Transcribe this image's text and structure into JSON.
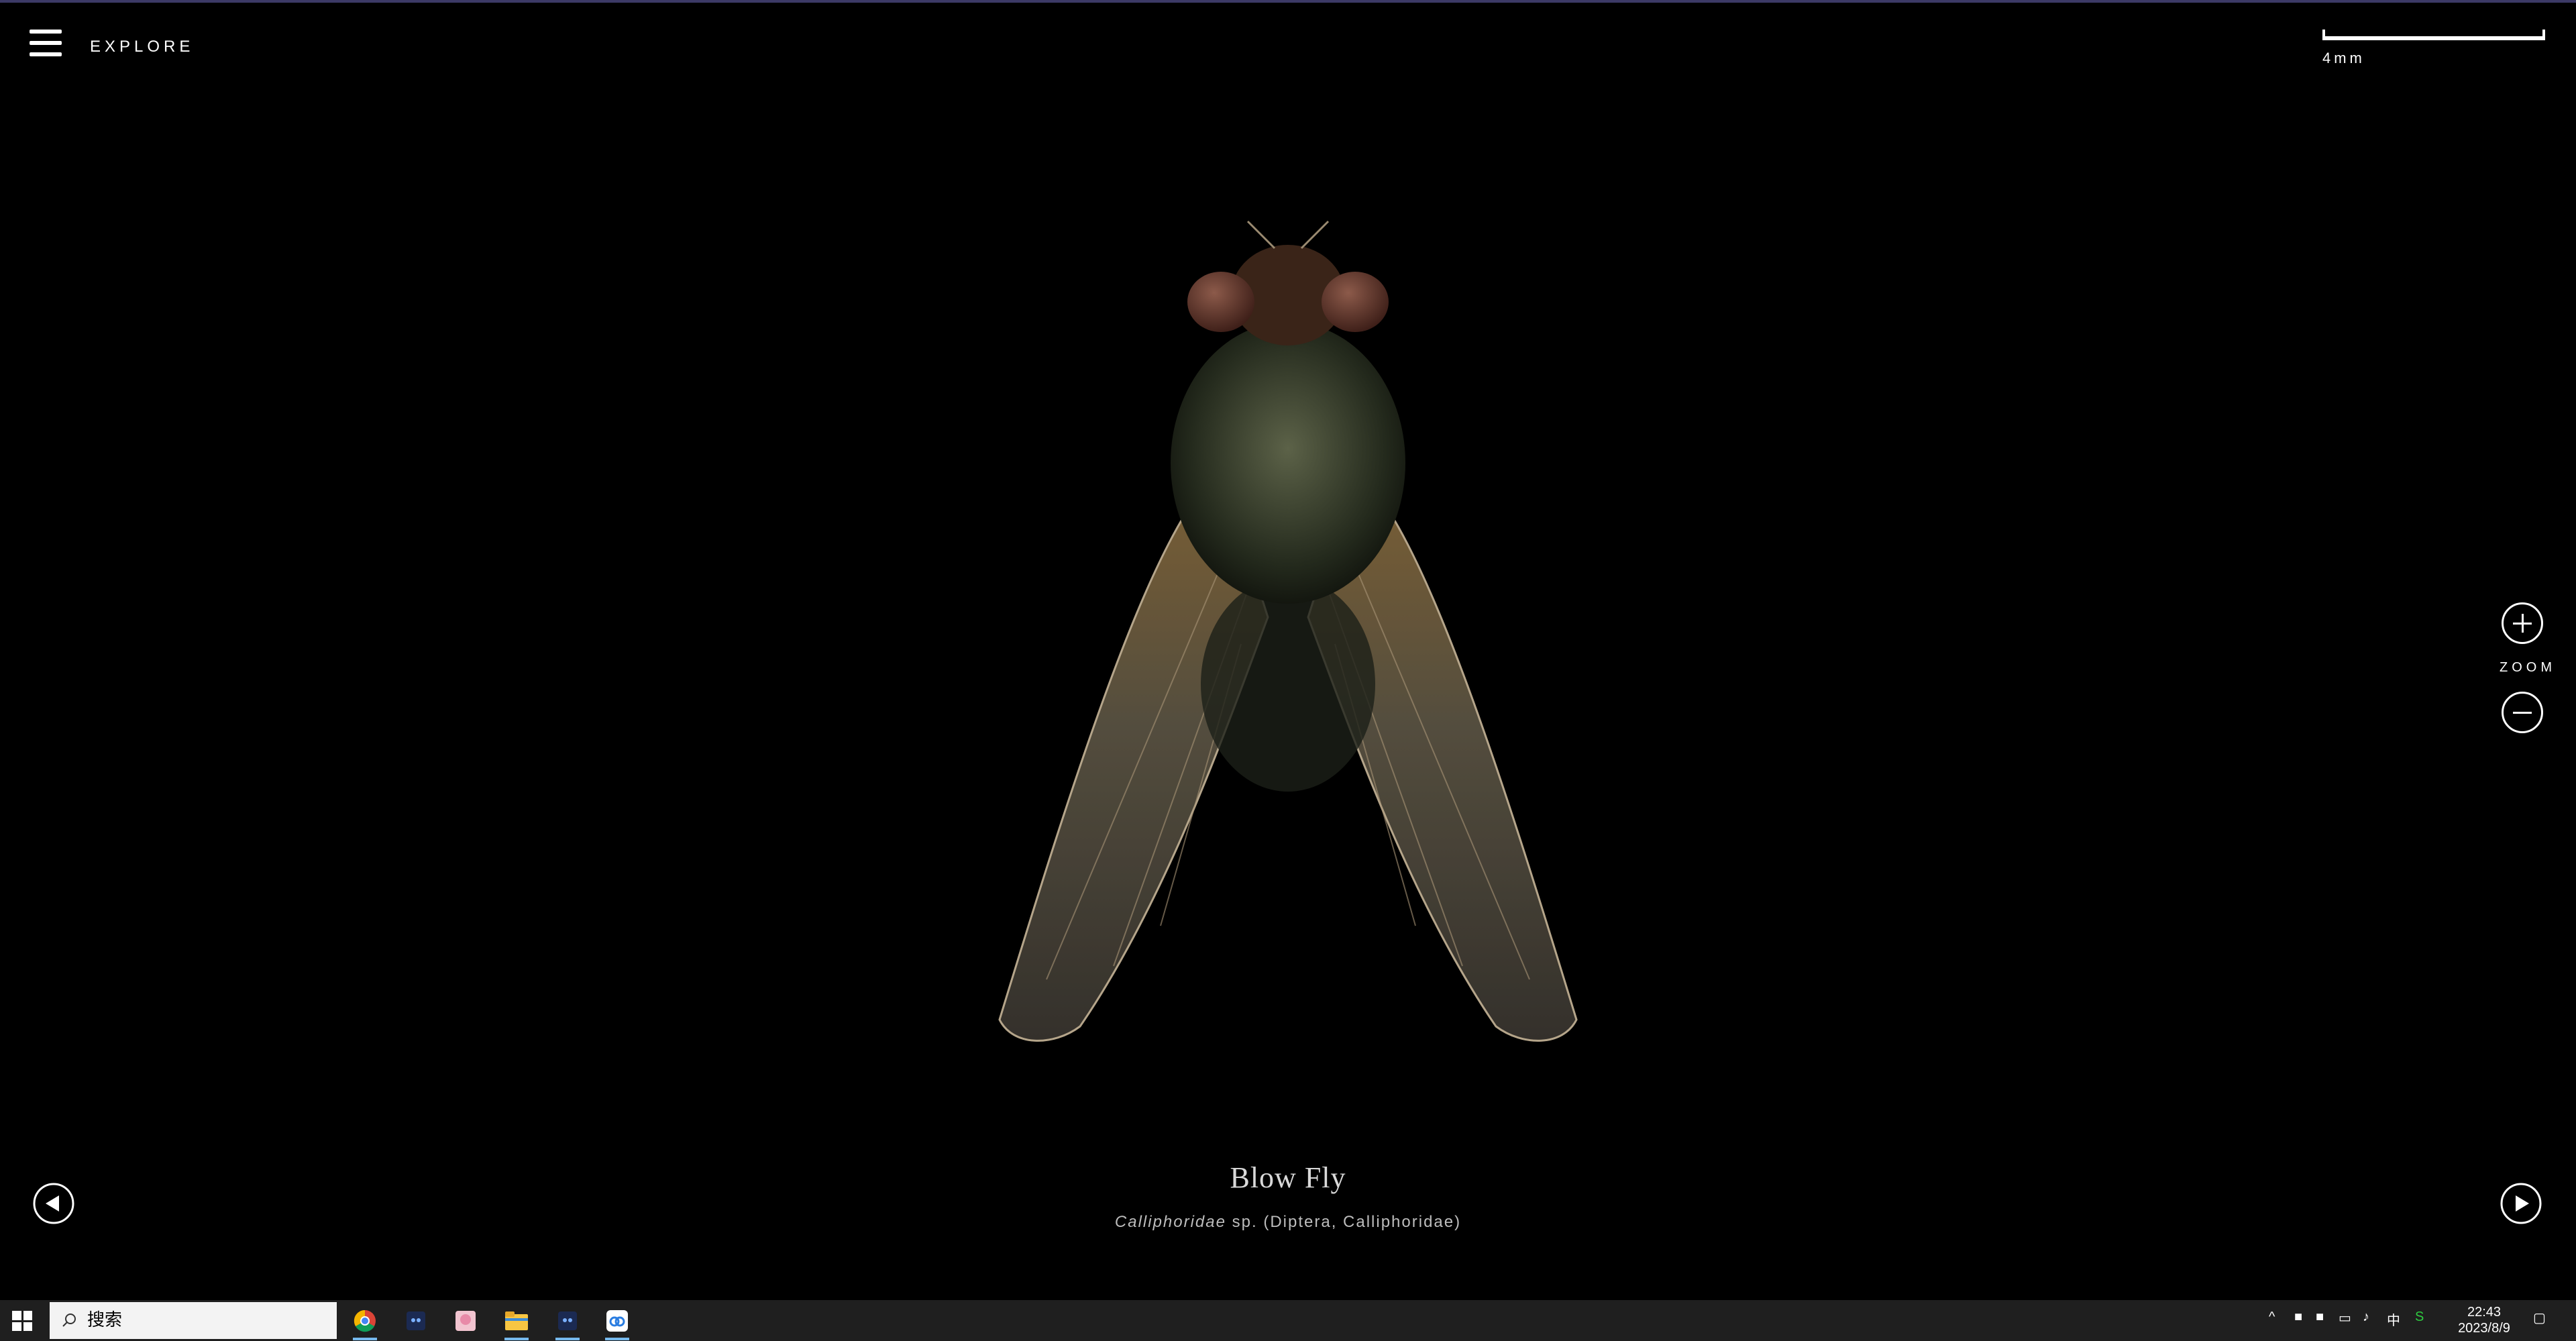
{
  "header": {
    "menu_icon": "hamburger-icon",
    "explore_label": "EXPLORE"
  },
  "scale_bar": {
    "label": "4mm"
  },
  "zoom": {
    "label": "ZOOM",
    "in_icon": "plus-circle-icon",
    "out_icon": "minus-circle-icon"
  },
  "navigation": {
    "prev_icon": "play-left-icon",
    "next_icon": "play-right-icon"
  },
  "specimen": {
    "common_name": "Blow Fly",
    "scientific_genus": "Calliphoridae",
    "scientific_rest": " sp. (Diptera, Calliphoridae)"
  },
  "taskbar": {
    "search_placeholder": "搜索",
    "apps": [
      "chrome-icon",
      "app-icon",
      "anime-app-icon",
      "file-explorer-icon",
      "app-icon",
      "cloud-app-icon"
    ],
    "time": "22:43",
    "date": "2023/8/9"
  },
  "colors": {
    "background": "#000000",
    "accent_line": "#3c3a66",
    "taskbar": "#1f1f1f"
  }
}
